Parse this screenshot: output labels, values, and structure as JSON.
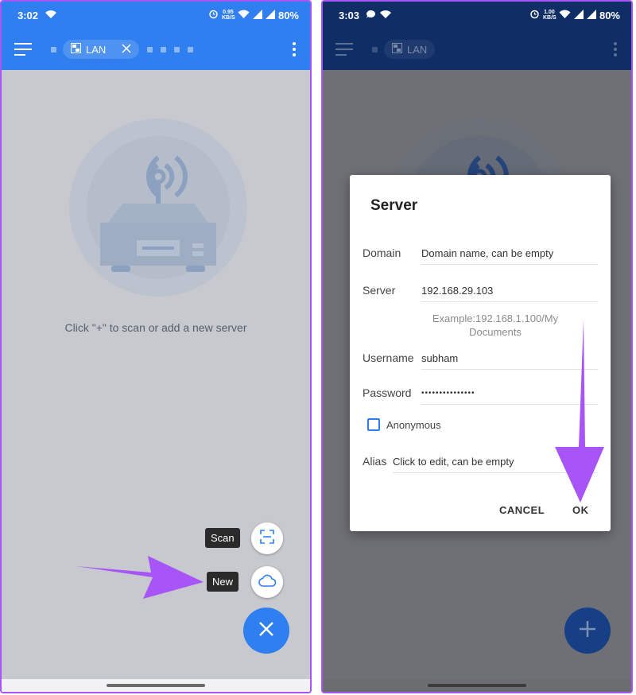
{
  "left": {
    "status_time": "3:02",
    "net_speed_value": "0.95",
    "net_speed_unit": "KB/S",
    "battery": "80%",
    "tab_label": "LAN",
    "empty_message": "Click \"+\" to scan or add a new server",
    "fab_scan_label": "Scan",
    "fab_new_label": "New"
  },
  "right": {
    "status_time": "3:03",
    "net_speed_value": "1.00",
    "net_speed_unit": "KB/S",
    "battery": "80%",
    "tab_label": "LAN",
    "dialog": {
      "title": "Server",
      "domain_label": "Domain",
      "domain_placeholder": "Domain name, can be empty",
      "server_label": "Server",
      "server_value": "192.168.29.103",
      "server_hint": "Example:192.168.1.100/My Documents",
      "username_label": "Username",
      "username_value": "subham",
      "password_label": "Password",
      "password_value": "•••••••••••••••",
      "anonymous_label": "Anonymous",
      "alias_label": "Alias",
      "alias_placeholder": "Click to edit, can be empty",
      "cancel_label": "CANCEL",
      "ok_label": "OK"
    }
  },
  "colors": {
    "accent_blue": "#2f7ff0",
    "annotation_purple": "#a855f7"
  }
}
